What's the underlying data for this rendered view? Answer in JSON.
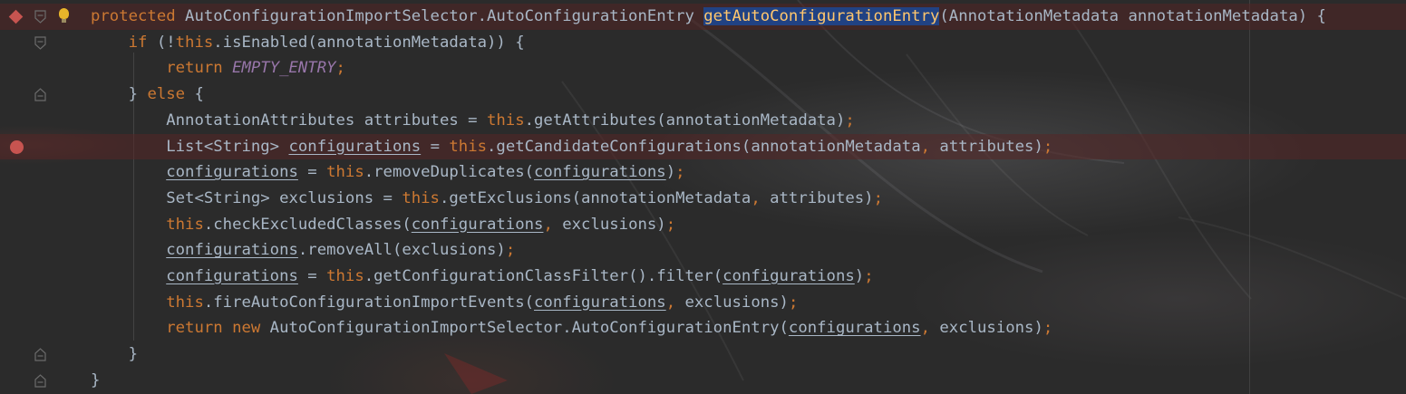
{
  "colors": {
    "background": "#2b2b2b",
    "keyword": "#cc7832",
    "method": "#ffc66d",
    "field": "#9876aa",
    "text": "#a9b7c6",
    "selection": "#214283",
    "breakpoint": "#c75450"
  },
  "icons": {
    "gutter_line1": [
      "diamond-breakpoint-icon",
      "fold-icon",
      "lightbulb-icon"
    ],
    "gutter_line6": [
      "breakpoint-icon"
    ]
  },
  "code": {
    "lines": [
      {
        "tokens": [
          {
            "t": "protected",
            "c": "kw"
          },
          {
            "t": " AutoConfigurationImportSelector.AutoConfigurationEntry ",
            "c": ""
          },
          {
            "t": "getAutoConfigurationEntry",
            "c": "hl"
          },
          {
            "t": "(AnnotationMetadata annotationMetadata) {",
            "c": ""
          }
        ]
      },
      {
        "tokens": [
          {
            "t": "    ",
            "c": ""
          },
          {
            "t": "if",
            "c": "kw"
          },
          {
            "t": " (!",
            "c": ""
          },
          {
            "t": "this",
            "c": "kw"
          },
          {
            "t": ".isEnabled(annotationMetadata)) {",
            "c": ""
          }
        ]
      },
      {
        "tokens": [
          {
            "t": "        ",
            "c": ""
          },
          {
            "t": "return",
            "c": "kw"
          },
          {
            "t": " ",
            "c": ""
          },
          {
            "t": "EMPTY_ENTRY",
            "c": "field"
          },
          {
            "t": ";",
            "c": "punc"
          }
        ]
      },
      {
        "tokens": [
          {
            "t": "    } ",
            "c": ""
          },
          {
            "t": "else",
            "c": "kw"
          },
          {
            "t": " {",
            "c": ""
          }
        ]
      },
      {
        "tokens": [
          {
            "t": "        AnnotationAttributes attributes = ",
            "c": ""
          },
          {
            "t": "this",
            "c": "kw"
          },
          {
            "t": ".getAttributes(annotationMetadata)",
            "c": ""
          },
          {
            "t": ";",
            "c": "punc"
          }
        ]
      },
      {
        "tokens": [
          {
            "t": "        List<String> ",
            "c": ""
          },
          {
            "t": "configurations",
            "c": "u"
          },
          {
            "t": " = ",
            "c": ""
          },
          {
            "t": "this",
            "c": "kw"
          },
          {
            "t": ".getCandidateConfigurations(annotationMetadata",
            "c": ""
          },
          {
            "t": ",",
            "c": "punc"
          },
          {
            "t": " attributes)",
            "c": ""
          },
          {
            "t": ";",
            "c": "punc"
          }
        ]
      },
      {
        "tokens": [
          {
            "t": "        ",
            "c": ""
          },
          {
            "t": "configurations",
            "c": "u"
          },
          {
            "t": " = ",
            "c": ""
          },
          {
            "t": "this",
            "c": "kw"
          },
          {
            "t": ".removeDuplicates(",
            "c": ""
          },
          {
            "t": "configurations",
            "c": "u"
          },
          {
            "t": ")",
            "c": ""
          },
          {
            "t": ";",
            "c": "punc"
          }
        ]
      },
      {
        "tokens": [
          {
            "t": "        Set<String> exclusions = ",
            "c": ""
          },
          {
            "t": "this",
            "c": "kw"
          },
          {
            "t": ".getExclusions(annotationMetadata",
            "c": ""
          },
          {
            "t": ",",
            "c": "punc"
          },
          {
            "t": " attributes)",
            "c": ""
          },
          {
            "t": ";",
            "c": "punc"
          }
        ]
      },
      {
        "tokens": [
          {
            "t": "        ",
            "c": ""
          },
          {
            "t": "this",
            "c": "kw"
          },
          {
            "t": ".checkExcludedClasses(",
            "c": ""
          },
          {
            "t": "configurations",
            "c": "u"
          },
          {
            "t": ",",
            "c": "punc"
          },
          {
            "t": " exclusions)",
            "c": ""
          },
          {
            "t": ";",
            "c": "punc"
          }
        ]
      },
      {
        "tokens": [
          {
            "t": "        ",
            "c": ""
          },
          {
            "t": "configurations",
            "c": "u"
          },
          {
            "t": ".removeAll(exclusions)",
            "c": ""
          },
          {
            "t": ";",
            "c": "punc"
          }
        ]
      },
      {
        "tokens": [
          {
            "t": "        ",
            "c": ""
          },
          {
            "t": "configurations",
            "c": "u"
          },
          {
            "t": " = ",
            "c": ""
          },
          {
            "t": "this",
            "c": "kw"
          },
          {
            "t": ".getConfigurationClassFilter().filter(",
            "c": ""
          },
          {
            "t": "configurations",
            "c": "u"
          },
          {
            "t": ")",
            "c": ""
          },
          {
            "t": ";",
            "c": "punc"
          }
        ]
      },
      {
        "tokens": [
          {
            "t": "        ",
            "c": ""
          },
          {
            "t": "this",
            "c": "kw"
          },
          {
            "t": ".fireAutoConfigurationImportEvents(",
            "c": ""
          },
          {
            "t": "configurations",
            "c": "u"
          },
          {
            "t": ",",
            "c": "punc"
          },
          {
            "t": " exclusions)",
            "c": ""
          },
          {
            "t": ";",
            "c": "punc"
          }
        ]
      },
      {
        "tokens": [
          {
            "t": "        ",
            "c": ""
          },
          {
            "t": "return new",
            "c": "kw"
          },
          {
            "t": " AutoConfigurationImportSelector.AutoConfigurationEntry(",
            "c": ""
          },
          {
            "t": "configurations",
            "c": "u"
          },
          {
            "t": ",",
            "c": "punc"
          },
          {
            "t": " exclusions)",
            "c": ""
          },
          {
            "t": ";",
            "c": "punc"
          }
        ]
      },
      {
        "tokens": [
          {
            "t": "    }",
            "c": ""
          }
        ]
      },
      {
        "tokens": [
          {
            "t": "}",
            "c": ""
          }
        ]
      }
    ]
  }
}
